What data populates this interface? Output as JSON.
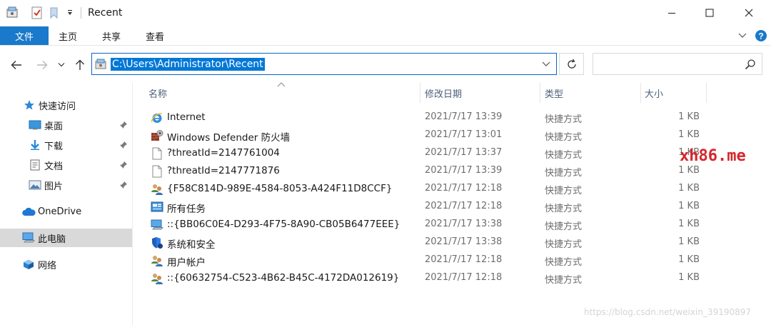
{
  "window": {
    "title": "Recent",
    "controls": [
      "minimize",
      "maximize",
      "close"
    ]
  },
  "ribbon": {
    "tabs": [
      {
        "label": "文件",
        "active": true
      },
      {
        "label": "主页"
      },
      {
        "label": "共享"
      },
      {
        "label": "查看"
      }
    ]
  },
  "address": {
    "path": "C:\\Users\\Administrator\\Recent",
    "search_placeholder": ""
  },
  "nav": {
    "items": [
      {
        "label": "快速访问",
        "icon": "star-icon"
      },
      {
        "label": "桌面",
        "icon": "desktop-icon",
        "pinned": true
      },
      {
        "label": "下载",
        "icon": "download-icon",
        "pinned": true
      },
      {
        "label": "文档",
        "icon": "document-icon",
        "pinned": true
      },
      {
        "label": "图片",
        "icon": "pictures-icon",
        "pinned": true
      },
      {
        "label": "OneDrive",
        "icon": "cloud-icon"
      },
      {
        "label": "此电脑",
        "icon": "computer-icon",
        "selected": true
      },
      {
        "label": "网络",
        "icon": "network-icon"
      }
    ]
  },
  "columns": [
    "名称",
    "修改日期",
    "类型",
    "大小"
  ],
  "files": [
    {
      "name": "Internet",
      "date": "2021/7/17 13:39",
      "type": "快捷方式",
      "size": "1 KB",
      "icon": "internet-explorer-icon"
    },
    {
      "name": "Windows Defender 防火墙",
      "date": "2021/7/17 13:01",
      "type": "快捷方式",
      "size": "1 KB",
      "icon": "firewall-icon"
    },
    {
      "name": "?threatId=2147761004",
      "date": "2021/7/17 13:37",
      "type": "快捷方式",
      "size": "1 KB",
      "icon": "blank-file-icon"
    },
    {
      "name": "?threatId=2147771876",
      "date": "2021/7/17 13:39",
      "type": "快捷方式",
      "size": "1 KB",
      "icon": "blank-file-icon"
    },
    {
      "name": "{F58C814D-989E-4584-8053-A424F11D8CCF}",
      "date": "2021/7/17 12:18",
      "type": "快捷方式",
      "size": "1 KB",
      "icon": "users-icon"
    },
    {
      "name": "所有任务",
      "date": "2021/7/17 12:18",
      "type": "快捷方式",
      "size": "1 KB",
      "icon": "control-panel-icon"
    },
    {
      "name": "::{BB06C0E4-D293-4F75-8A90-CB05B6477EEE}",
      "date": "2021/7/17 13:38",
      "type": "快捷方式",
      "size": "1 KB",
      "icon": "computer-icon"
    },
    {
      "name": "系统和安全",
      "date": "2021/7/17 13:38",
      "type": "快捷方式",
      "size": "1 KB",
      "icon": "shield-icon"
    },
    {
      "name": "用户帐户",
      "date": "2021/7/17 12:18",
      "type": "快捷方式",
      "size": "1 KB",
      "icon": "users-icon"
    },
    {
      "name": "::{60632754-C523-4B62-B45C-4172DA012619}",
      "date": "2021/7/17 12:18",
      "type": "快捷方式",
      "size": "1 KB",
      "icon": "users-icon"
    }
  ],
  "watermarks": {
    "brand": "xh86.me",
    "url": "https://blog.csdn.net/weixin_39190897"
  },
  "colors": {
    "accent": "#1979ca",
    "selection": "#0078d7",
    "brand_watermark": "#d6262b"
  }
}
